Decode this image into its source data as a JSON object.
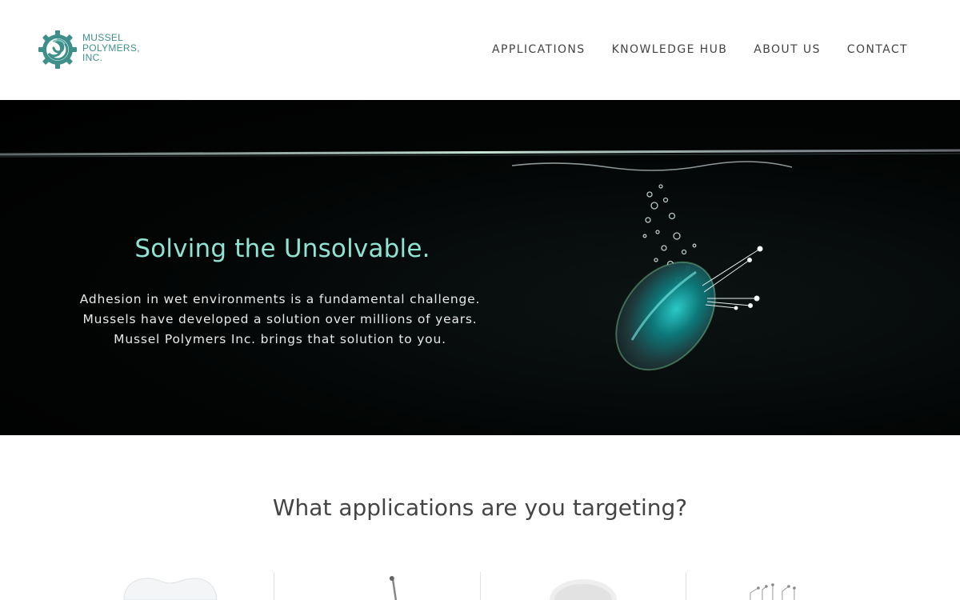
{
  "header": {
    "logo": {
      "line1": "MUSSEL",
      "line2": "POLYMERS,",
      "line3": "INC.",
      "icon": "gear-swirl-logo-icon",
      "color": "#3e8f8a"
    },
    "nav": [
      {
        "label": "APPLICATIONS"
      },
      {
        "label": "KNOWLEDGE HUB"
      },
      {
        "label": "ABOUT US"
      },
      {
        "label": "CONTACT"
      }
    ]
  },
  "hero": {
    "title": "Solving the Unsolvable.",
    "lines": [
      "Adhesion in wet environments is a fundamental challenge.",
      "Mussels have developed a solution over millions of years.",
      "Mussel Polymers Inc. brings that solution to you."
    ],
    "image": "mussel-underwater-image",
    "title_color": "#8fe3d2"
  },
  "applications": {
    "title": "What applications are you targeting?",
    "cards": [
      {
        "image": "tooth-image"
      },
      {
        "image": "surgical-instrument-image"
      },
      {
        "image": "cotton-fiber-image"
      },
      {
        "image": "circuit-board-image"
      }
    ]
  }
}
